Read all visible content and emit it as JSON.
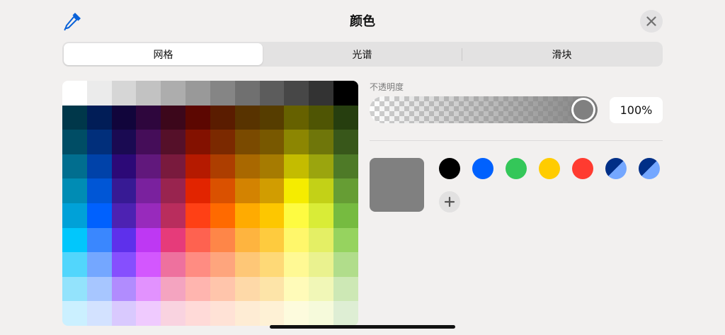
{
  "header": {
    "title": "颜色",
    "eyedropper_icon": "eyedropper-icon",
    "close_icon": "close-icon"
  },
  "tabs": [
    {
      "label": "网格",
      "active": true
    },
    {
      "label": "光谱",
      "active": false
    },
    {
      "label": "滑块",
      "active": false
    }
  ],
  "grid": {
    "rows": [
      [
        "#ffffff",
        "#ebebeb",
        "#d6d6d6",
        "#c2c2c2",
        "#adadad",
        "#999999",
        "#858585",
        "#707070",
        "#5c5c5c",
        "#474747",
        "#333333",
        "#000000"
      ],
      [
        "#00374a",
        "#011d57",
        "#11053b",
        "#2e063d",
        "#3c071b",
        "#5c0701",
        "#5a1c00",
        "#583300",
        "#563d00",
        "#666100",
        "#4f5504",
        "#263e0f"
      ],
      [
        "#004d65",
        "#012f7b",
        "#1a0a52",
        "#450d59",
        "#551029",
        "#831100",
        "#7b2900",
        "#7a4a00",
        "#785800",
        "#8c8602",
        "#6f760a",
        "#38571a"
      ],
      [
        "#016e8f",
        "#0042a9",
        "#2c0977",
        "#61187c",
        "#791a3d",
        "#b51a00",
        "#ad3e00",
        "#a96800",
        "#a67b01",
        "#c4bc00",
        "#9ba50e",
        "#4e7a27"
      ],
      [
        "#008cb4",
        "#0056d6",
        "#371a94",
        "#7a219e",
        "#99244f",
        "#e22400",
        "#da5100",
        "#d38301",
        "#d19d01",
        "#f5ec00",
        "#c3d117",
        "#669d34"
      ],
      [
        "#00a1d8",
        "#0061fe",
        "#4d22b2",
        "#982abc",
        "#b92d5d",
        "#ff4015",
        "#ff6a00",
        "#ffab01",
        "#fdc700",
        "#fefb41",
        "#d9ec37",
        "#76bb40"
      ],
      [
        "#01c7fc",
        "#3a87fe",
        "#5e30eb",
        "#be38f3",
        "#e63b7a",
        "#fe6250",
        "#fe8648",
        "#feb43f",
        "#fecb3e",
        "#fff76b",
        "#e4ef65",
        "#96d35f"
      ],
      [
        "#52d6fc",
        "#74a7ff",
        "#864ffe",
        "#d357fe",
        "#ee719e",
        "#ff8c82",
        "#fea57d",
        "#fec777",
        "#fed977",
        "#fff994",
        "#eaf28f",
        "#b1dd8b"
      ],
      [
        "#93e3fc",
        "#a7c6ff",
        "#b18cfe",
        "#e292fe",
        "#f4a4c0",
        "#ffb5af",
        "#ffc5ab",
        "#fed9a8",
        "#fde4a8",
        "#fffbb9",
        "#f1f7b7",
        "#cde8b5"
      ],
      [
        "#cbf0ff",
        "#d3e2ff",
        "#d9c9fe",
        "#efcafe",
        "#f9d3e0",
        "#ffdad8",
        "#ffe2d6",
        "#feecd4",
        "#fef1d5",
        "#fdfbdd",
        "#f6fadb",
        "#deeed4"
      ]
    ]
  },
  "opacity": {
    "label": "不透明度",
    "value": "100%",
    "level": 1.0
  },
  "current_color": "#808080",
  "saved_colors": [
    {
      "type": "solid",
      "color": "#000000"
    },
    {
      "type": "solid",
      "color": "#0061fe"
    },
    {
      "type": "solid",
      "color": "#34c759"
    },
    {
      "type": "solid",
      "color": "#ffcc00"
    },
    {
      "type": "solid",
      "color": "#ff3b30"
    },
    {
      "type": "split",
      "color": "#002f87",
      "color2": "#74a7ff"
    },
    {
      "type": "split",
      "color": "#002f87",
      "color2": "#74a7ff"
    }
  ],
  "add_icon": "plus-icon"
}
